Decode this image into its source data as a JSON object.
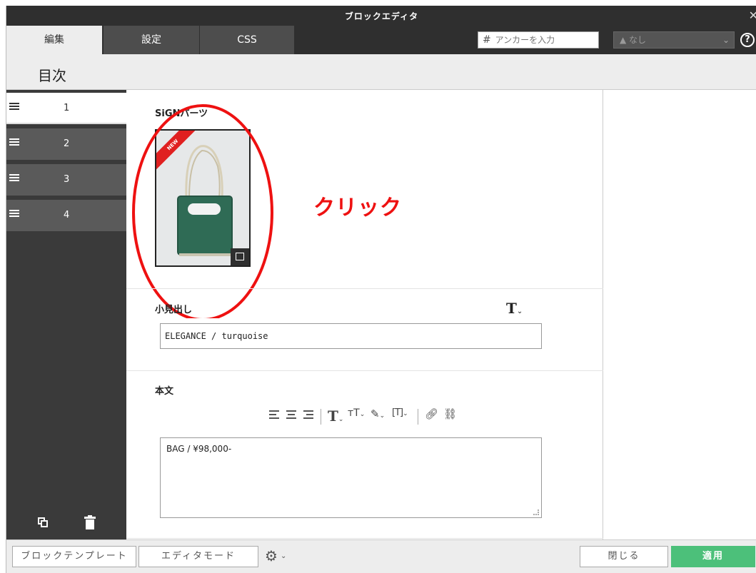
{
  "window": {
    "title": "ブロックエディタ",
    "close_glyph": "✕"
  },
  "tabs": [
    {
      "label": "編集",
      "active": true
    },
    {
      "label": "設定",
      "active": false
    },
    {
      "label": "CSS",
      "active": false
    }
  ],
  "anchor": {
    "hash": "#",
    "placeholder": "アンカーを入力"
  },
  "style_select": {
    "value": "なし",
    "icon": "style-icon"
  },
  "help_glyph": "?",
  "toc": {
    "title": "目次",
    "items": [
      {
        "num": "1",
        "active": true
      },
      {
        "num": "2",
        "active": false
      },
      {
        "num": "3",
        "active": false
      },
      {
        "num": "4",
        "active": false
      }
    ]
  },
  "fields": {
    "image_label": "SiGNパーツ",
    "image_badge": "NEW",
    "annotation_text": "クリック",
    "heading_label": "小見出し",
    "heading_value": "ELEGANCE / turquoise",
    "body_label": "本文",
    "body_value": "BAG / ¥98,000-"
  },
  "footer": {
    "template_label": "ブロックテンプレート",
    "editor_mode_label": "エディタモード",
    "close_label": "閉じる",
    "apply_label": "適用"
  },
  "colors": {
    "accent_green": "#4cc07a",
    "annotation_red": "#e11111",
    "dark_bg": "#2f2f2f"
  }
}
